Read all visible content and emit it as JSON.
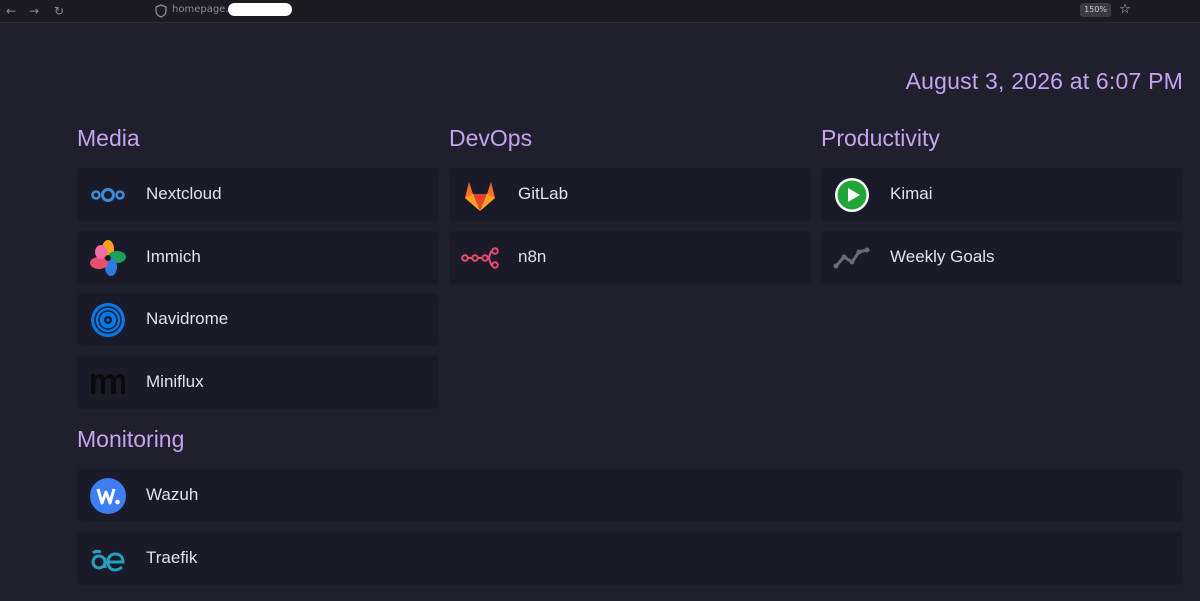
{
  "browser": {
    "url_prefix": "homepage.",
    "zoom": "150%",
    "back_glyph": "←",
    "forward_glyph": "→",
    "reload_glyph": "↻",
    "star_glyph": "☆"
  },
  "datetime": "August 3, 2026 at 6:07 PM",
  "groups": {
    "media": {
      "title": "Media",
      "services": [
        {
          "name": "Nextcloud",
          "icon": "nextcloud-icon"
        },
        {
          "name": "Immich",
          "icon": "immich-icon"
        },
        {
          "name": "Navidrome",
          "icon": "navidrome-icon"
        },
        {
          "name": "Miniflux",
          "icon": "miniflux-icon"
        }
      ]
    },
    "devops": {
      "title": "DevOps",
      "services": [
        {
          "name": "GitLab",
          "icon": "gitlab-icon"
        },
        {
          "name": "n8n",
          "icon": "n8n-icon"
        }
      ]
    },
    "productivity": {
      "title": "Productivity",
      "services": [
        {
          "name": "Kimai",
          "icon": "kimai-icon"
        },
        {
          "name": "Weekly Goals",
          "icon": "chart-line-icon"
        }
      ]
    },
    "monitoring": {
      "title": "Monitoring",
      "services": [
        {
          "name": "Wazuh",
          "icon": "wazuh-icon"
        },
        {
          "name": "Traefik",
          "icon": "traefik-icon"
        }
      ]
    }
  },
  "colors": {
    "background": "#1f1f2e",
    "card": "#1a1a28",
    "accent": "#c6a3ee",
    "text": "#e2e2ec"
  }
}
